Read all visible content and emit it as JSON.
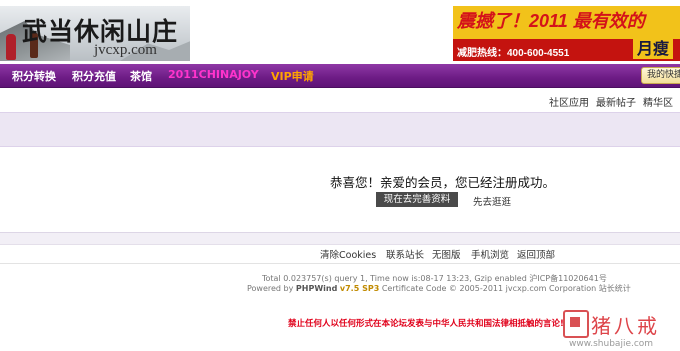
{
  "header": {
    "logo_title": "武当休闲山庄",
    "logo_domain": "jvcxp.com",
    "ad_headline": "震撼了！2011 最有效的",
    "ad_hotline": "减肥热线：400-600-4551",
    "ad_tag": "月瘦"
  },
  "nav": {
    "items": [
      {
        "label": "积分转换"
      },
      {
        "label": "积分充值"
      },
      {
        "label": "茶馆"
      },
      {
        "label": "2011CHINAJOY"
      },
      {
        "label": "VIP申请"
      }
    ],
    "quick_label": "我的快捷"
  },
  "subnav": {
    "items": [
      {
        "label": "社区应用"
      },
      {
        "label": "最新帖子"
      },
      {
        "label": "精华区"
      }
    ]
  },
  "main": {
    "message": "恭喜您！亲爱的会员，您已经注册成功。",
    "complete_button": "现在去完善资料",
    "browse_link": "先去逛逛"
  },
  "footer": {
    "links": [
      {
        "label": "清除Cookies"
      },
      {
        "label": "联系站长"
      },
      {
        "label": "无图版"
      },
      {
        "label": "手机浏览"
      },
      {
        "label": "返回顶部"
      }
    ],
    "stats": "Total 0.023757(s) query 1, Time now is:08-17 13:23, Gzip enabled 沪ICP备11020641号",
    "powered_prefix": "Powered by ",
    "powered_brand": "PHPWind",
    "powered_version": "v7.5 SP3",
    "powered_suffix": "Certificate Code © 2005-2011 jvcxp.com Corporation 站长统计",
    "warning": "禁止任何人以任何形式在本论坛发表与中华人民共和国法律相抵触的言论!"
  },
  "watermark": {
    "title": "猪八戒",
    "url": "www.shubajie.com"
  },
  "colors": {
    "nav_purple": "#6d1c85",
    "nav_pink": "#ff33cc",
    "nav_orange": "#ffa500",
    "warning_red": "#e0001a",
    "button_dark": "#4a4a4a"
  }
}
